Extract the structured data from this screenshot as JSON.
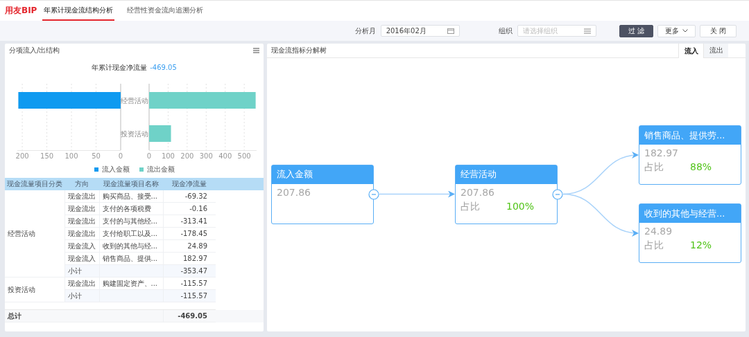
{
  "header": {
    "logo": "用友BIP",
    "tabs": [
      {
        "label": "年累计现金流结构分析",
        "selected": true
      },
      {
        "label": "经营性资金流向追溯分析",
        "selected": false
      }
    ]
  },
  "toolbar": {
    "month_label": "分析月",
    "month_value": "2016年02月",
    "org_label": "组织",
    "org_placeholder": "请选择组织",
    "buttons": [
      {
        "label": "过 滤",
        "kind": "primary"
      },
      {
        "label": "更多",
        "kind": "dropdown"
      },
      {
        "label": "关 闭",
        "kind": "plain"
      }
    ]
  },
  "left_panel": {
    "title": "分项流入/出结构",
    "chart_title": "年累计现金净流量",
    "chart_value": "-469.05",
    "inflow_chart": {
      "chart_data": {
        "type": "bar",
        "orientation": "horizontal",
        "grid": true,
        "xlim": [
          210,
          0
        ],
        "xticks": [
          200,
          150,
          100,
          50,
          0
        ],
        "series": [
          {
            "name": "流入金额",
            "color": "#0f9af0",
            "values": [
              208,
              null
            ]
          }
        ]
      }
    },
    "outflow_chart": {
      "chart_data": {
        "type": "bar",
        "orientation": "horizontal",
        "grid": true,
        "categories": [
          "经营活动",
          "投资活动"
        ],
        "xlim": [
          0,
          565
        ],
        "xticks": [
          0,
          100,
          200,
          300,
          400,
          500
        ],
        "series": [
          {
            "name": "流出金额",
            "color": "#6fd2c8",
            "values": [
              560,
              115
            ]
          }
        ]
      }
    },
    "table": {
      "columns": [
        "现金流量项目分类",
        "方向",
        "现金流量项目名称",
        "现金净流量"
      ],
      "groups": [
        {
          "category": "经营活动",
          "rows": [
            {
              "kind": "item",
              "direction": "现金流出",
              "name": "购买商品、接受...",
              "amount": "-69.32"
            },
            {
              "kind": "item",
              "direction": "现金流出",
              "name": "支付的各项税费",
              "amount": "-0.16"
            },
            {
              "kind": "item",
              "direction": "现金流出",
              "name": "支付的与其他经...",
              "amount": "-313.41"
            },
            {
              "kind": "item",
              "direction": "现金流出",
              "name": "支付给职工以及...",
              "amount": "-178.45"
            },
            {
              "kind": "item",
              "direction": "现金流入",
              "name": "收到的其他与经...",
              "amount": "24.89"
            },
            {
              "kind": "item",
              "direction": "现金流入",
              "name": "销售商品、提供...",
              "amount": "182.97"
            },
            {
              "kind": "subtotal",
              "direction": "小计",
              "amount": "-353.47"
            }
          ]
        },
        {
          "category": "投资活动",
          "rows": [
            {
              "kind": "item",
              "direction": "现金流出",
              "name": "购建固定资产、...",
              "amount": "-115.57"
            },
            {
              "kind": "subtotal",
              "direction": "小计",
              "amount": "-115.57"
            }
          ]
        }
      ],
      "total": {
        "label": "总计",
        "amount": "-469.05"
      }
    }
  },
  "right_panel": {
    "title": "现金流指标分解树",
    "tabs": [
      {
        "label": "流入",
        "selected": true
      },
      {
        "label": "流出",
        "selected": false
      }
    ],
    "tree": {
      "title": "流入金额",
      "value": "207.86",
      "expanded": true,
      "children": [
        {
          "title": "经营活动",
          "value": "207.86",
          "share_label": "占比",
          "share": "100%",
          "expanded": true,
          "children": [
            {
              "title": "销售商品、提供劳...",
              "value": "182.97",
              "share_label": "占比",
              "share": "88%"
            },
            {
              "title": "收到的其他与经营...",
              "value": "24.89",
              "share_label": "占比",
              "share": "12%"
            }
          ]
        }
      ]
    }
  }
}
